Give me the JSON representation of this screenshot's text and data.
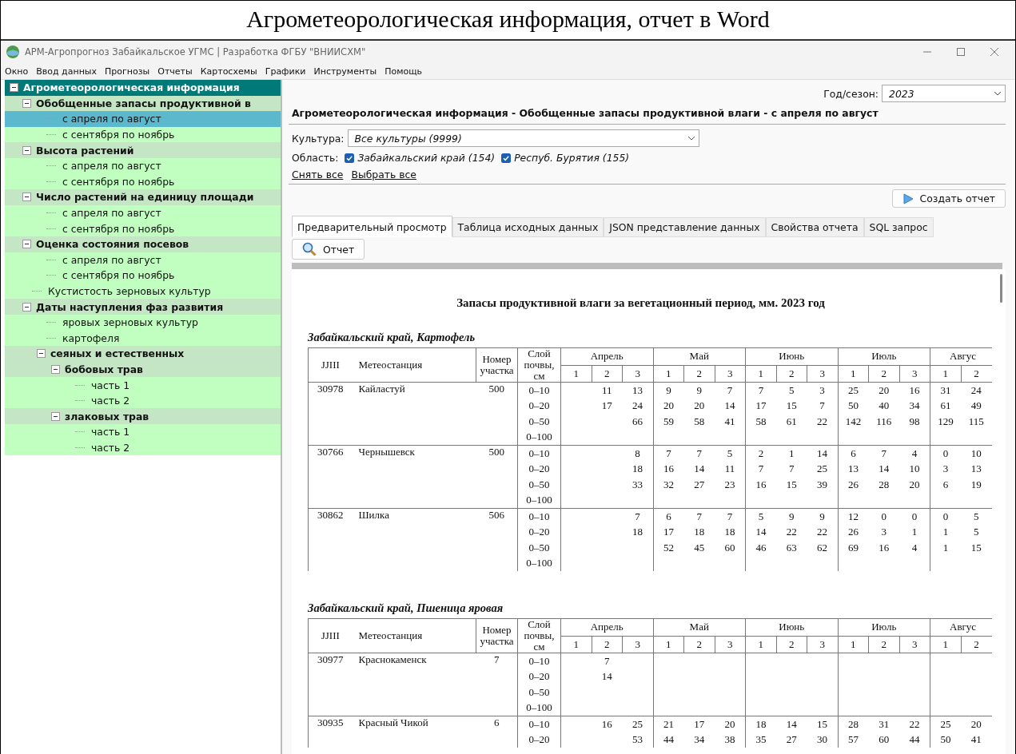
{
  "caption": "Агрометеорологическая информация, отчет в Word",
  "window": {
    "title": "АРМ-Агропрогноз Забайкальское УГМС | Разработка ФГБУ \"ВНИИСХМ\""
  },
  "menu": [
    "Окно",
    "Ввод данных",
    "Прогнозы",
    "Отчеты",
    "Картосхемы",
    "Графики",
    "Инструменты",
    "Помощь"
  ],
  "tree": [
    {
      "label": "Агрометеорологическая информация",
      "expanded": true,
      "selected": false,
      "children": [
        {
          "label": "Обобщенные запасы продуктивной в",
          "expanded": true,
          "selected": false,
          "children": [
            {
              "label": "с апреля по август",
              "selected": true
            },
            {
              "label": "с сентября по ноябрь",
              "selected": false
            }
          ]
        },
        {
          "label": "Высота растений",
          "expanded": true,
          "selected": false,
          "children": [
            {
              "label": "с апреля по август",
              "selected": false
            },
            {
              "label": "с сентября по ноябрь",
              "selected": false
            }
          ]
        },
        {
          "label": "Число растений на единицу площади",
          "expanded": true,
          "selected": false,
          "children": [
            {
              "label": "с апреля по август",
              "selected": false
            },
            {
              "label": "с сентября по ноябрь",
              "selected": false
            }
          ]
        },
        {
          "label": "Оценка состояния посевов",
          "expanded": true,
          "selected": false,
          "children": [
            {
              "label": "с апреля по август",
              "selected": false
            },
            {
              "label": "с сентября по ноябрь",
              "selected": false
            }
          ]
        },
        {
          "label": "Кустистость зерновых культур",
          "selected": false
        },
        {
          "label": "Даты наступления фаз развития",
          "expanded": true,
          "selected": false,
          "children": [
            {
              "label": "яровых зерновых культур",
              "selected": false
            },
            {
              "label": "картофеля",
              "selected": false
            },
            {
              "label": "сеяных и естественных",
              "expanded": true,
              "selected": false,
              "children": [
                {
                  "label": "бобовых трав",
                  "expanded": true,
                  "selected": false,
                  "children": [
                    {
                      "label": "часть 1",
                      "selected": false
                    },
                    {
                      "label": "часть 2",
                      "selected": false
                    }
                  ]
                },
                {
                  "label": "злаковых трав",
                  "expanded": true,
                  "selected": false,
                  "children": [
                    {
                      "label": "часть 1",
                      "selected": false
                    },
                    {
                      "label": "часть 2",
                      "selected": false
                    }
                  ]
                }
              ]
            }
          ]
        }
      ]
    }
  ],
  "season": {
    "label": "Год/сезон:",
    "value": "2023"
  },
  "heading": "Агрометеорологическая информация - Обобщенные запасы продуктивной влаги - с апреля по август",
  "culture": {
    "label": "Культура:",
    "value": "Все культуры (9999)"
  },
  "region": {
    "label": "Область:",
    "options": [
      {
        "label": "Забайкальский край (154)",
        "checked": true
      },
      {
        "label": "Респуб. Бурятия (155)",
        "checked": true
      }
    ]
  },
  "links": [
    "Снять все",
    "Выбрать все"
  ],
  "create_button": "Создать отчет",
  "tabs": [
    {
      "label": "Предварительный просмотр",
      "selected": true
    },
    {
      "label": "Таблица исходных данных",
      "selected": false
    },
    {
      "label": "JSON представление данных",
      "selected": false
    },
    {
      "label": "Свойства отчета",
      "selected": false
    },
    {
      "label": "SQL запрос",
      "selected": false
    }
  ],
  "report_button": "Отчет",
  "report": {
    "title": "Запасы продуктивной влаги за вегетационный период, мм. 2023 год",
    "sections": [
      {
        "title": "Забайкальский край, Картофель",
        "columns": {
          "id": "JJIII",
          "station": "Метеостанция",
          "plot": "Номер участка",
          "layer": "Слой почвы, см",
          "months": [
            {
              "name": "Апрель",
              "decades": [
                "1",
                "2",
                "3"
              ]
            },
            {
              "name": "Май",
              "decades": [
                "1",
                "2",
                "3"
              ]
            },
            {
              "name": "Июнь",
              "decades": [
                "1",
                "2",
                "3"
              ]
            },
            {
              "name": "Июль",
              "decades": [
                "1",
                "2",
                "3"
              ]
            },
            {
              "name": "Авгус",
              "decades": [
                "1",
                "2"
              ]
            }
          ]
        },
        "rows": [
          {
            "id": "30978",
            "station": "Кайластуй",
            "plot": "500",
            "layers": [
              {
                "layer": "0–10",
                "values": [
                  {
                    "kind": "empty"
                  },
                  {
                    "kind": "value",
                    "text": "11"
                  },
                  {
                    "kind": "value",
                    "text": "13"
                  },
                  {
                    "kind": "value",
                    "text": "9"
                  },
                  {
                    "kind": "value",
                    "text": "9"
                  },
                  {
                    "kind": "value",
                    "text": "7"
                  },
                  {
                    "kind": "value",
                    "text": "7"
                  },
                  {
                    "kind": "value",
                    "text": "5"
                  },
                  {
                    "kind": "value",
                    "text": "3"
                  },
                  {
                    "kind": "value",
                    "text": "25"
                  },
                  {
                    "kind": "value",
                    "text": "20"
                  },
                  {
                    "kind": "value",
                    "text": "16"
                  },
                  {
                    "kind": "value",
                    "text": "31"
                  },
                  {
                    "kind": "value",
                    "text": "24"
                  }
                ]
              },
              {
                "layer": "0–20",
                "values": [
                  {
                    "kind": "empty"
                  },
                  {
                    "kind": "value",
                    "text": "17"
                  },
                  {
                    "kind": "value",
                    "text": "24"
                  },
                  {
                    "kind": "value",
                    "text": "20"
                  },
                  {
                    "kind": "value",
                    "text": "20"
                  },
                  {
                    "kind": "value",
                    "text": "14"
                  },
                  {
                    "kind": "value",
                    "text": "17"
                  },
                  {
                    "kind": "value",
                    "text": "15"
                  },
                  {
                    "kind": "value",
                    "text": "7"
                  },
                  {
                    "kind": "value",
                    "text": "50"
                  },
                  {
                    "kind": "value",
                    "text": "40"
                  },
                  {
                    "kind": "value",
                    "text": "34"
                  },
                  {
                    "kind": "value",
                    "text": "61"
                  },
                  {
                    "kind": "value",
                    "text": "49"
                  }
                ]
              },
              {
                "layer": "0–50",
                "values": [
                  {
                    "kind": "empty"
                  },
                  {
                    "kind": "empty"
                  },
                  {
                    "kind": "value",
                    "text": "66"
                  },
                  {
                    "kind": "value",
                    "text": "59"
                  },
                  {
                    "kind": "value",
                    "text": "58"
                  },
                  {
                    "kind": "value",
                    "text": "41"
                  },
                  {
                    "kind": "value",
                    "text": "58"
                  },
                  {
                    "kind": "value",
                    "text": "61"
                  },
                  {
                    "kind": "value",
                    "text": "22"
                  },
                  {
                    "kind": "value",
                    "text": "142"
                  },
                  {
                    "kind": "value",
                    "text": "116"
                  },
                  {
                    "kind": "value",
                    "text": "98"
                  },
                  {
                    "kind": "value",
                    "text": "129"
                  },
                  {
                    "kind": "value",
                    "text": "115"
                  }
                ]
              },
              {
                "layer": "0–100"
              }
            ]
          },
          {
            "id": "30766",
            "station": "Чернышевск",
            "plot": "500",
            "layers": [
              {
                "layer": "0–10",
                "values": [
                  {
                    "kind": "empty"
                  },
                  {
                    "kind": "empty"
                  },
                  {
                    "kind": "value",
                    "text": "8"
                  },
                  {
                    "kind": "value",
                    "text": "7"
                  },
                  {
                    "kind": "value",
                    "text": "7"
                  },
                  {
                    "kind": "value",
                    "text": "5"
                  },
                  {
                    "kind": "value",
                    "text": "2"
                  },
                  {
                    "kind": "value",
                    "text": "1"
                  },
                  {
                    "kind": "value",
                    "text": "14"
                  },
                  {
                    "kind": "value",
                    "text": "6"
                  },
                  {
                    "kind": "value",
                    "text": "7"
                  },
                  {
                    "kind": "value",
                    "text": "4"
                  },
                  {
                    "kind": "value",
                    "text": "0"
                  },
                  {
                    "kind": "value",
                    "text": "10"
                  }
                ]
              },
              {
                "layer": "0–20",
                "values": [
                  {
                    "kind": "empty"
                  },
                  {
                    "kind": "empty"
                  },
                  {
                    "kind": "value",
                    "text": "18"
                  },
                  {
                    "kind": "value",
                    "text": "16"
                  },
                  {
                    "kind": "value",
                    "text": "14"
                  },
                  {
                    "kind": "value",
                    "text": "11"
                  },
                  {
                    "kind": "value",
                    "text": "7"
                  },
                  {
                    "kind": "value",
                    "text": "7"
                  },
                  {
                    "kind": "value",
                    "text": "25"
                  },
                  {
                    "kind": "value",
                    "text": "13"
                  },
                  {
                    "kind": "value",
                    "text": "14"
                  },
                  {
                    "kind": "value",
                    "text": "10"
                  },
                  {
                    "kind": "value",
                    "text": "3"
                  },
                  {
                    "kind": "value",
                    "text": "13"
                  }
                ]
              },
              {
                "layer": "0–50",
                "values": [
                  {
                    "kind": "empty"
                  },
                  {
                    "kind": "empty"
                  },
                  {
                    "kind": "value",
                    "text": "33"
                  },
                  {
                    "kind": "value",
                    "text": "32"
                  },
                  {
                    "kind": "value",
                    "text": "27"
                  },
                  {
                    "kind": "value",
                    "text": "23"
                  },
                  {
                    "kind": "value",
                    "text": "16"
                  },
                  {
                    "kind": "value",
                    "text": "15"
                  },
                  {
                    "kind": "value",
                    "text": "39"
                  },
                  {
                    "kind": "value",
                    "text": "26"
                  },
                  {
                    "kind": "value",
                    "text": "28"
                  },
                  {
                    "kind": "value",
                    "text": "20"
                  },
                  {
                    "kind": "value",
                    "text": "6"
                  },
                  {
                    "kind": "value",
                    "text": "19"
                  }
                ]
              },
              {
                "layer": "0–100"
              }
            ]
          },
          {
            "id": "30862",
            "station": "Шилка",
            "plot": "506",
            "layers": [
              {
                "layer": "0–10",
                "values": [
                  {
                    "kind": "empty"
                  },
                  {
                    "kind": "empty"
                  },
                  {
                    "kind": "value",
                    "text": "7"
                  },
                  {
                    "kind": "value",
                    "text": "6"
                  },
                  {
                    "kind": "value",
                    "text": "7"
                  },
                  {
                    "kind": "value",
                    "text": "7"
                  },
                  {
                    "kind": "value",
                    "text": "5"
                  },
                  {
                    "kind": "value",
                    "text": "9"
                  },
                  {
                    "kind": "value",
                    "text": "9"
                  },
                  {
                    "kind": "value",
                    "text": "12"
                  },
                  {
                    "kind": "value",
                    "text": "0"
                  },
                  {
                    "kind": "value",
                    "text": "0"
                  },
                  {
                    "kind": "value",
                    "text": "0"
                  },
                  {
                    "kind": "value",
                    "text": "5"
                  }
                ]
              },
              {
                "layer": "0–20",
                "values": [
                  {
                    "kind": "empty"
                  },
                  {
                    "kind": "empty"
                  },
                  {
                    "kind": "value",
                    "text": "18"
                  },
                  {
                    "kind": "value",
                    "text": "17"
                  },
                  {
                    "kind": "value",
                    "text": "18"
                  },
                  {
                    "kind": "value",
                    "text": "18"
                  },
                  {
                    "kind": "value",
                    "text": "14"
                  },
                  {
                    "kind": "value",
                    "text": "22"
                  },
                  {
                    "kind": "value",
                    "text": "22"
                  },
                  {
                    "kind": "value",
                    "text": "26"
                  },
                  {
                    "kind": "value",
                    "text": "3"
                  },
                  {
                    "kind": "value",
                    "text": "1"
                  },
                  {
                    "kind": "value",
                    "text": "1"
                  },
                  {
                    "kind": "value",
                    "text": "5"
                  }
                ]
              },
              {
                "layer": "0–50",
                "values": [
                  {
                    "kind": "empty"
                  },
                  {
                    "kind": "empty"
                  },
                  {
                    "kind": "empty"
                  },
                  {
                    "kind": "value",
                    "text": "52"
                  },
                  {
                    "kind": "value",
                    "text": "45"
                  },
                  {
                    "kind": "value",
                    "text": "60"
                  },
                  {
                    "kind": "value",
                    "text": "46"
                  },
                  {
                    "kind": "value",
                    "text": "63"
                  },
                  {
                    "kind": "value",
                    "text": "62"
                  },
                  {
                    "kind": "value",
                    "text": "69"
                  },
                  {
                    "kind": "value",
                    "text": "16"
                  },
                  {
                    "kind": "value",
                    "text": "4"
                  },
                  {
                    "kind": "value",
                    "text": "1"
                  },
                  {
                    "kind": "value",
                    "text": "15"
                  }
                ]
              },
              {
                "layer": "0–100"
              }
            ]
          }
        ]
      },
      {
        "title": "Забайкальский край, Пшеница яровая",
        "columns": {
          "id": "JJIII",
          "station": "Метеостанция",
          "plot": "Номер участка",
          "layer": "Слой почвы, см",
          "months": [
            {
              "name": "Апрель",
              "decades": [
                "1",
                "2",
                "3"
              ]
            },
            {
              "name": "Май",
              "decades": [
                "1",
                "2",
                "3"
              ]
            },
            {
              "name": "Июнь",
              "decades": [
                "1",
                "2",
                "3"
              ]
            },
            {
              "name": "Июль",
              "decades": [
                "1",
                "2",
                "3"
              ]
            },
            {
              "name": "Авгус",
              "decades": [
                "1",
                "2"
              ]
            }
          ]
        },
        "rows": [
          {
            "id": "30977",
            "station": "Краснокаменск",
            "plot": "7",
            "layers": [
              {
                "layer": "0–10",
                "values": [
                  {
                    "kind": "empty"
                  },
                  {
                    "kind": "value",
                    "text": "7"
                  }
                ]
              },
              {
                "layer": "0–20",
                "values": [
                  {
                    "kind": "empty"
                  },
                  {
                    "kind": "value",
                    "text": "14"
                  }
                ]
              },
              {
                "layer": "0–50"
              },
              {
                "layer": "0–100"
              }
            ]
          },
          {
            "id": "30935",
            "station": "Красный Чикой",
            "plot": "6",
            "layers": [
              {
                "layer": "0–10",
                "values": [
                  {
                    "kind": "empty"
                  },
                  {
                    "kind": "value",
                    "text": "16"
                  },
                  {
                    "kind": "value",
                    "text": "25"
                  },
                  {
                    "kind": "value",
                    "text": "21"
                  },
                  {
                    "kind": "value",
                    "text": "17"
                  },
                  {
                    "kind": "value",
                    "text": "20"
                  },
                  {
                    "kind": "value",
                    "text": "18"
                  },
                  {
                    "kind": "value",
                    "text": "14"
                  },
                  {
                    "kind": "value",
                    "text": "15"
                  },
                  {
                    "kind": "value",
                    "text": "28"
                  },
                  {
                    "kind": "value",
                    "text": "31"
                  },
                  {
                    "kind": "value",
                    "text": "22"
                  },
                  {
                    "kind": "value",
                    "text": "25"
                  },
                  {
                    "kind": "value",
                    "text": "20"
                  }
                ]
              },
              {
                "layer": "0–20",
                "values": [
                  {
                    "kind": "empty"
                  },
                  {
                    "kind": "empty"
                  },
                  {
                    "kind": "value",
                    "text": "53"
                  },
                  {
                    "kind": "value",
                    "text": "44"
                  },
                  {
                    "kind": "value",
                    "text": "34"
                  },
                  {
                    "kind": "value",
                    "text": "38"
                  },
                  {
                    "kind": "value",
                    "text": "35"
                  },
                  {
                    "kind": "value",
                    "text": "27"
                  },
                  {
                    "kind": "value",
                    "text": "30"
                  },
                  {
                    "kind": "value",
                    "text": "57"
                  },
                  {
                    "kind": "value",
                    "text": "60"
                  },
                  {
                    "kind": "value",
                    "text": "44"
                  },
                  {
                    "kind": "value",
                    "text": "50"
                  },
                  {
                    "kind": "value",
                    "text": "41"
                  }
                ]
              }
            ]
          }
        ]
      }
    ]
  }
}
